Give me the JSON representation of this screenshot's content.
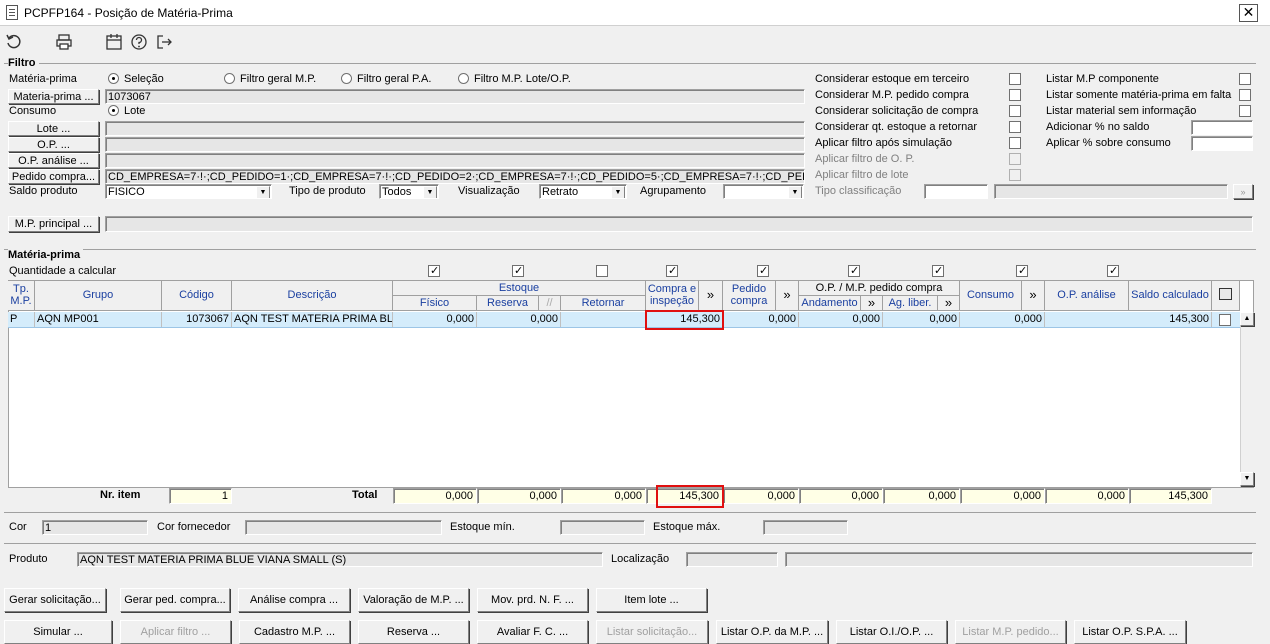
{
  "window": {
    "title": "PCPFP164 - Posição de Matéria-Prima",
    "close": "✕"
  },
  "toolbar": {
    "icons": [
      "refresh-icon",
      "print-icon",
      "calendar-icon",
      "help-icon",
      "exit-icon"
    ]
  },
  "filtro": {
    "title": "Filtro",
    "materia_prima_label": "Matéria-prima",
    "radios": [
      "Seleção",
      "Filtro geral M.P.",
      "Filtro geral P.A.",
      "Filtro M.P. Lote/O.P."
    ],
    "materia_prima_button": "Materia-prima ...",
    "materia_prima_value": "1073067",
    "consumo_label": "Consumo",
    "consumo_radio": "Lote",
    "lote_button": "Lote ...",
    "op_button": "O.P. ...",
    "op_analise_button": "O.P. análise ...",
    "pedido_compra_button": "Pedido compra...",
    "pedido_compra_value": "CD_EMPRESA=7·!·;CD_PEDIDO=1·;CD_EMPRESA=7·!·;CD_PEDIDO=2·;CD_EMPRESA=7·!·;CD_PEDIDO=5·;CD_EMPRESA=7·!·;CD_PEDIDO=6·;CD_E",
    "saldo_produto_label": "Saldo produto",
    "saldo_produto_value": "FISICO",
    "tipo_produto_label": "Tipo de produto",
    "tipo_produto_value": "Todos",
    "visualizacao_label": "Visualização",
    "visualizacao_value": "Retrato",
    "agrupamento_label": "Agrupamento",
    "agrupamento_value": "",
    "mp_principal_button": "M.P. principal ...",
    "right_options": [
      "Considerar estoque em terceiro",
      "Considerar M.P. pedido compra",
      "Considerar solicitação de compra",
      "Considerar qt. estoque a retornar",
      "Aplicar filtro após simulação",
      "Aplicar filtro de O. P.",
      "Aplicar filtro de lote"
    ],
    "tipo_classificacao_label": "Tipo classificação",
    "far_options": [
      "Listar M.P componente",
      "Listar somente matéria-prima em falta",
      "Listar material sem informação",
      "Adicionar % no saldo",
      "Aplicar % sobre consumo"
    ]
  },
  "grid": {
    "title": "Matéria-prima",
    "qtd_label": "Quantidade a calcular",
    "headers": {
      "tp_mp": "Tp. M.P.",
      "grupo": "Grupo",
      "codigo": "Código",
      "descricao": "Descrição",
      "estoque": "Estoque",
      "fisico": "Físico",
      "reserva": "Reserva",
      "retornar": "Retornar",
      "compra_inspecao": "Compra e inspeção",
      "pedido_compra": "Pedido compra",
      "op_mp_pedido": "O.P. / M.P. pedido compra",
      "andamento": "Andamento",
      "ag_liber": "Ag. liber.",
      "consumo": "Consumo",
      "op_analise": "O.P. análise",
      "saldo_calculado": "Saldo calculado",
      "expand": "»",
      "slash": "//"
    },
    "row": {
      "tp": "P",
      "grupo": "AQN MP001",
      "codigo": "1073067",
      "descricao": "AQN TEST MATERIA PRIMA BLUE",
      "fisico": "0,000",
      "reserva": "0,000",
      "retornar": "",
      "compra": "145,300",
      "pedido": "0,000",
      "andamento": "0,000",
      "ag_liber": "0,000",
      "consumo": "0,000",
      "op_analise": "",
      "saldo": "145,300"
    },
    "footer": {
      "nr_item_label": "Nr. item",
      "nr_item_value": "1",
      "total_label": "Total",
      "fisico": "0,000",
      "reserva": "0,000",
      "retornar": "0,000",
      "compra": "145,300",
      "pedido": "0,000",
      "andamento": "0,000",
      "ag_liber": "0,000",
      "consumo": "0,000",
      "op_analise": "0,000",
      "saldo": "145,300"
    }
  },
  "details": {
    "cor_label": "Cor",
    "cor_value": "1",
    "cor_fornecedor_label": "Cor fornecedor",
    "estoque_min_label": "Estoque mín.",
    "estoque_max_label": "Estoque máx.",
    "produto_label": "Produto",
    "produto_value": "AQN TEST MATERIA PRIMA BLUE VIANA SMALL (S)",
    "localizacao_label": "Localização"
  },
  "actions": {
    "row1": [
      "Gerar solicitação...",
      "Gerar ped. compra...",
      "Análise compra ...",
      "Valoração de M.P. ...",
      "Mov. prd. N. F. ...",
      "Item lote ..."
    ],
    "row2": [
      "Simular ...",
      "Aplicar filtro ...",
      "Cadastro M.P. ...",
      "Reserva ...",
      "Avaliar F. C. ...",
      "Listar solicitação...",
      "Listar O.P. da M.P. ...",
      "Listar O.I./O.P. ...",
      "Listar M.P. pedido...",
      "Listar O.P. S.P.A. ..."
    ]
  }
}
